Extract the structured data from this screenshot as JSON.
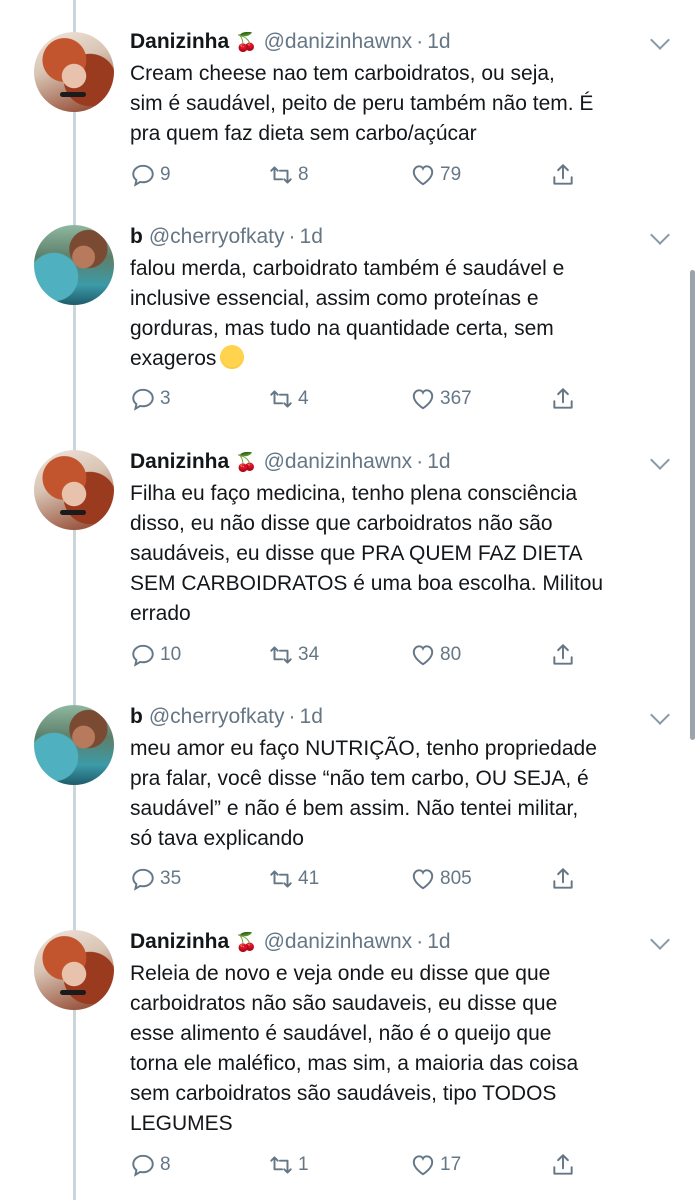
{
  "tweets": [
    {
      "name": "Danizinha",
      "emoji": "🍒",
      "handle": "@danizinhawnx",
      "time": "1d",
      "text": "Cream cheese nao tem carboidratos, ou seja,\nsim é saudável, peito de peru também não tem. É\npra quem faz dieta sem carbo/açúcar",
      "replies": "9",
      "retweets": "8",
      "likes": "79"
    },
    {
      "name": "b",
      "emoji": "",
      "handle": "@cherryofkaty",
      "time": "1d",
      "text": "falou merda, carboidrato também é saudável e\ninclusive essencial, assim como proteínas e\ngorduras, mas tudo na quantidade certa, sem\nexageros",
      "trailing_emoji": "hugging-face",
      "replies": "3",
      "retweets": "4",
      "likes": "367"
    },
    {
      "name": "Danizinha",
      "emoji": "🍒",
      "handle": "@danizinhawnx",
      "time": "1d",
      "text": "Filha eu faço medicina, tenho plena consciência\ndisso, eu não disse que carboidratos não são\nsaudáveis, eu disse que PRA QUEM FAZ DIETA\nSEM CARBOIDRATOS é uma boa escolha. Militou\nerrado",
      "replies": "10",
      "retweets": "34",
      "likes": "80"
    },
    {
      "name": "b",
      "emoji": "",
      "handle": "@cherryofkaty",
      "time": "1d",
      "text": "meu amor eu faço NUTRIÇÃO, tenho propriedade\npra falar, você disse “não tem carbo, OU SEJA, é\nsaudável” e não é bem assim. Não tentei militar,\nsó tava explicando",
      "replies": "35",
      "retweets": "41",
      "likes": "805"
    },
    {
      "name": "Danizinha",
      "emoji": "🍒",
      "handle": "@danizinhawnx",
      "time": "1d",
      "text": "Releia de novo e veja onde eu disse que que\ncarboidratos não são saudaveis, eu disse que\nesse alimento é saudável, não é o queijo que\ntorna ele maléfico, mas sim, a maioria das coisa\nsem carboidratos são saudáveis, tipo TODOS\nLEGUMES",
      "replies": "8",
      "retweets": "1",
      "likes": "17"
    }
  ],
  "icons": {
    "reply": "reply-icon",
    "retweet": "retweet-icon",
    "like": "heart-icon",
    "share": "share-icon",
    "more": "chevron-down-icon"
  },
  "colors": {
    "text": "#14171a",
    "secondary": "#657786",
    "thread_line": "#cdd5dc"
  }
}
